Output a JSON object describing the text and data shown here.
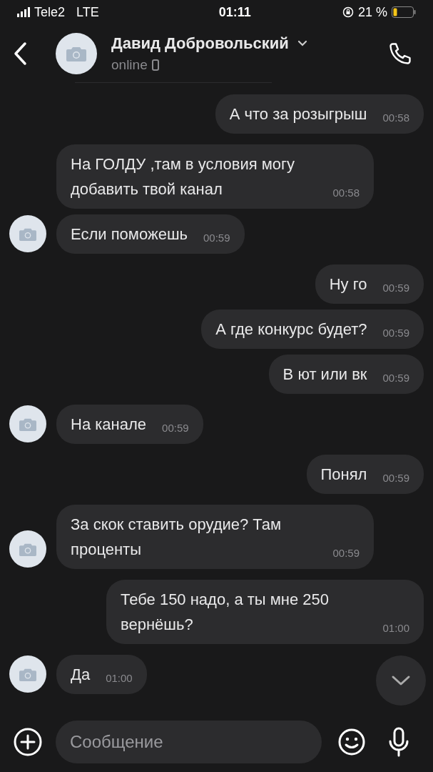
{
  "status_bar": {
    "carrier": "Tele2",
    "network": "LTE",
    "time": "01:11",
    "battery": "21 %"
  },
  "header": {
    "name": "Давид Добровольский",
    "status": "online"
  },
  "messages": [
    {
      "kind": "outgoing",
      "text": "А что за розыгрыш",
      "time": "00:58"
    },
    {
      "kind": "incoming",
      "text": "На ГОЛДУ ,там в условия могу добавить твой канал",
      "time": "00:58",
      "avatar": false
    },
    {
      "kind": "incoming",
      "text": "Если поможешь",
      "time": "00:59",
      "avatar": true
    },
    {
      "kind": "outgoing",
      "text": "Ну го",
      "time": "00:59"
    },
    {
      "kind": "outgoing",
      "text": "А где конкурс будет?",
      "time": "00:59"
    },
    {
      "kind": "outgoing",
      "text": "В ют или вк",
      "time": "00:59"
    },
    {
      "kind": "incoming",
      "text": "На канале",
      "time": "00:59",
      "avatar": true
    },
    {
      "kind": "outgoing",
      "text": "Понял",
      "time": "00:59"
    },
    {
      "kind": "incoming",
      "text": "За скок ставить орудие? Там проценты",
      "time": "00:59",
      "avatar": true
    },
    {
      "kind": "outgoing",
      "text": "Тебе 150 надо, а ты мне 250 вернёшь?",
      "time": "01:00"
    },
    {
      "kind": "incoming",
      "text": "Да",
      "time": "01:00",
      "avatar": true
    }
  ],
  "composer": {
    "placeholder": "Сообщение"
  }
}
